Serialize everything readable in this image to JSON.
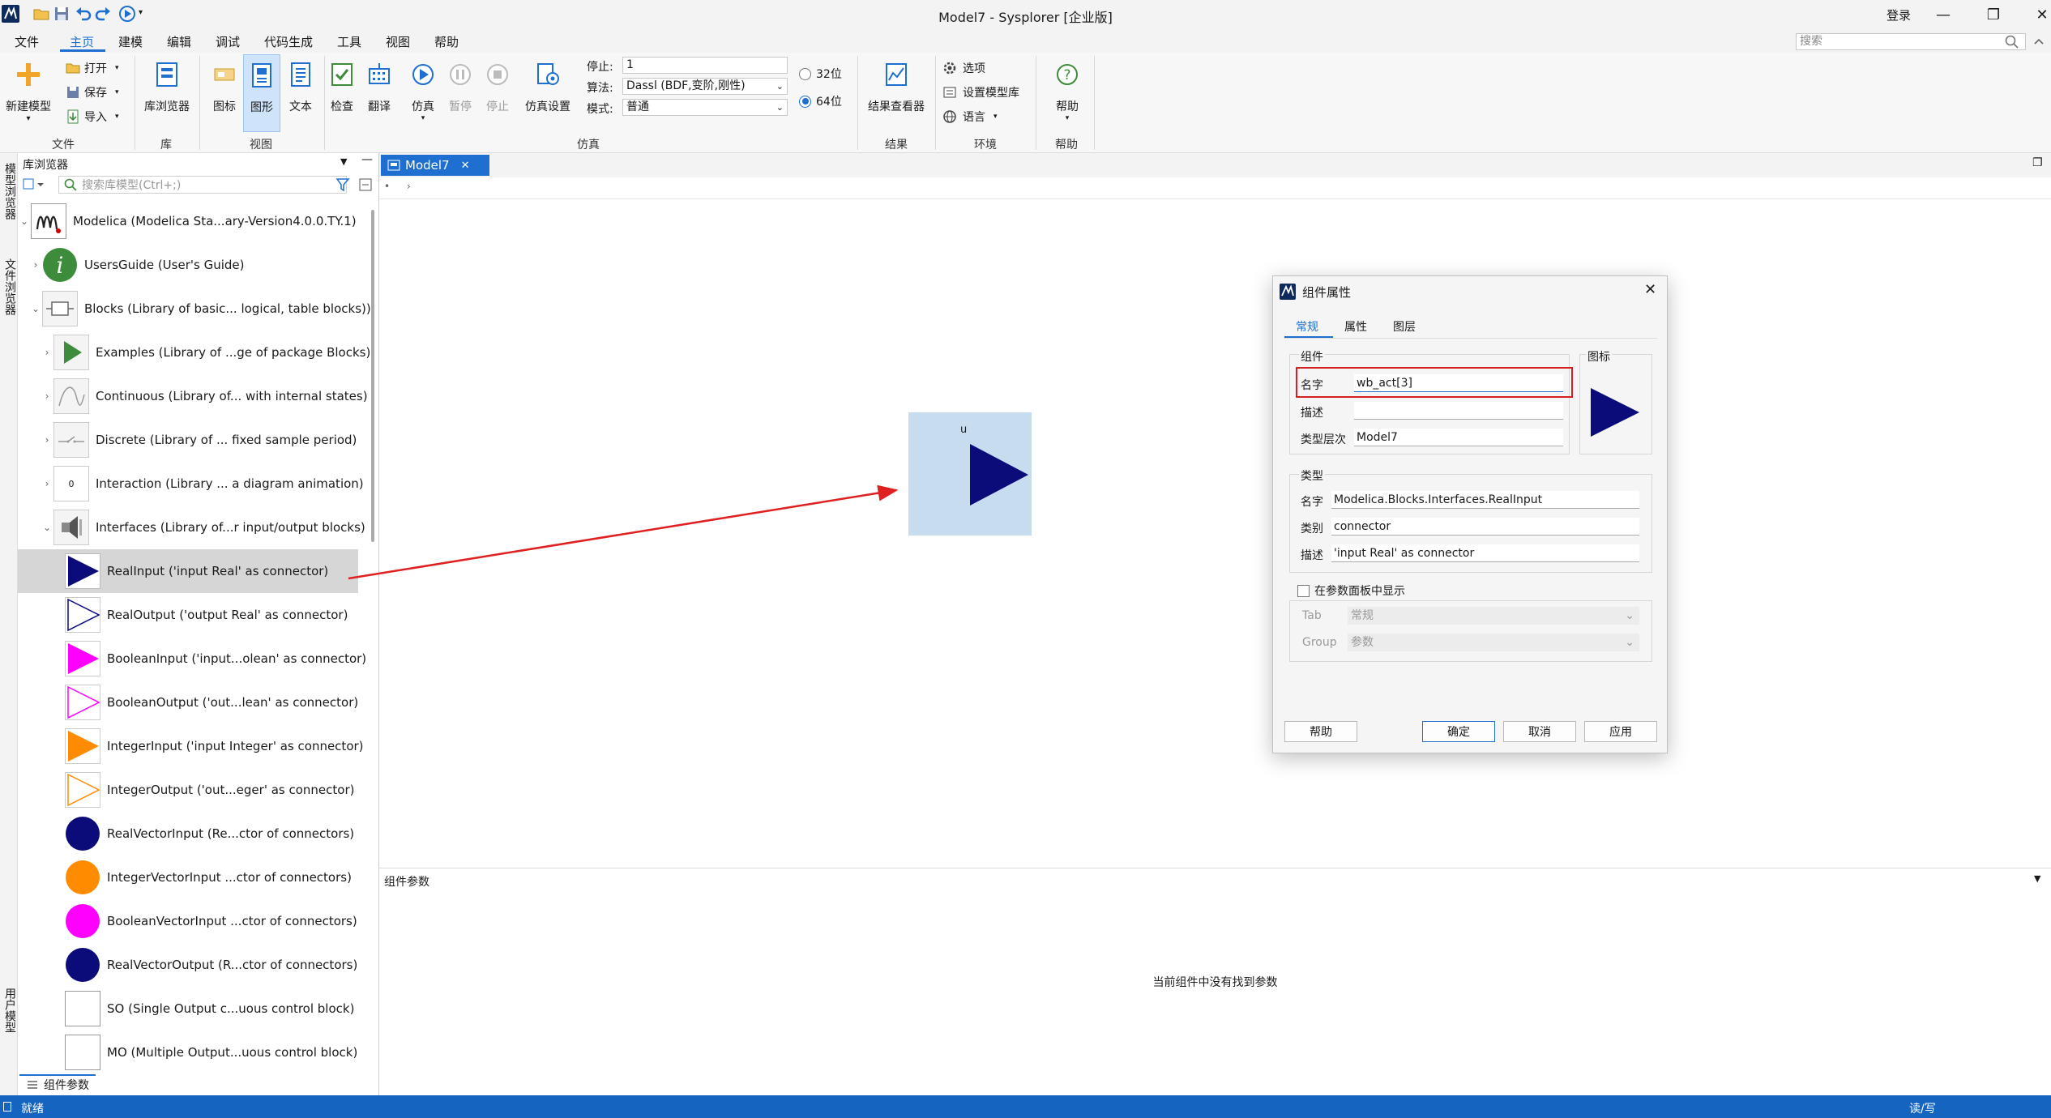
{
  "window": {
    "title": "Model7 - Sysplorer [企业版]",
    "login": "登录"
  },
  "menu": {
    "tabs": [
      "文件",
      "主页",
      "建模",
      "编辑",
      "调试",
      "代码生成",
      "工具",
      "视图",
      "帮助"
    ],
    "active": "主页",
    "search_placeholder": "搜索"
  },
  "ribbon": {
    "file": {
      "new_model": "新建模型",
      "open": "打开",
      "save": "保存",
      "import": "导入",
      "group": "文件"
    },
    "lib": {
      "browser": "库浏览器",
      "group": "库"
    },
    "view": {
      "icon": "图标",
      "diagram": "图形",
      "text": "文本",
      "group": "视图"
    },
    "sim": {
      "check": "检查",
      "translate": "翻译",
      "simulate": "仿真",
      "pause": "暂停",
      "stop": "停止",
      "settings": "仿真设置",
      "stop_label": "停止:",
      "stop_value": "1",
      "algo_label": "算法:",
      "algo_value": "Dassl (BDF,变阶,刚性)",
      "mode_label": "模式:",
      "mode_value": "普通",
      "bit32": "32位",
      "bit64": "64位",
      "group": "仿真"
    },
    "result": {
      "viewer": "结果查看器",
      "group": "结果"
    },
    "env": {
      "options": "选项",
      "set_lib": "设置模型库",
      "language": "语言",
      "group": "环境"
    },
    "help": {
      "help": "帮助",
      "group": "帮助"
    }
  },
  "vtabs": [
    "模型浏览器",
    "文件浏览器",
    "用户模型"
  ],
  "library": {
    "title": "库浏览器",
    "search_placeholder": "搜索库模型(Ctrl+;)",
    "items": [
      {
        "label": "Modelica (Modelica Sta...ary-Version4.0.0.TY.1)",
        "icon": "modelica-logo-icon"
      },
      {
        "label": "UsersGuide (User's Guide)",
        "icon": "info-icon"
      },
      {
        "label": "Blocks (Library of basic... logical, table blocks))",
        "icon": "blocks-icon"
      },
      {
        "label": "Examples (Library of ...ge of package Blocks)",
        "icon": "play-icon"
      },
      {
        "label": "Continuous (Library of... with internal states)",
        "icon": "continuous-icon"
      },
      {
        "label": "Discrete (Library of ... fixed sample period)",
        "icon": "discrete-icon"
      },
      {
        "label": "Interaction (Library ... a diagram animation)",
        "icon": "interaction-icon",
        "badge": "0"
      },
      {
        "label": "Interfaces (Library of...r input/output blocks)",
        "icon": "interfaces-icon"
      },
      {
        "label": "RealInput ('input Real' as connector)",
        "icon": "triangle-icon"
      },
      {
        "label": "RealOutput ('output Real' as connector)",
        "icon": "triangle-icon"
      },
      {
        "label": "BooleanInput ('input...olean' as connector)",
        "icon": "triangle-icon"
      },
      {
        "label": "BooleanOutput ('out...lean' as connector)",
        "icon": "triangle-icon"
      },
      {
        "label": "IntegerInput ('input Integer' as connector)",
        "icon": "triangle-icon"
      },
      {
        "label": "IntegerOutput ('out...eger' as connector)",
        "icon": "triangle-icon"
      },
      {
        "label": "RealVectorInput (Re...ctor of connectors)",
        "icon": "circle-icon"
      },
      {
        "label": "IntegerVectorInput ...ctor of connectors)",
        "icon": "circle-icon"
      },
      {
        "label": "BooleanVectorInput ...ctor of connectors)",
        "icon": "circle-icon"
      },
      {
        "label": "RealVectorOutput (R...ctor of connectors)",
        "icon": "circle-icon"
      },
      {
        "label": "SO (Single Output c...uous control block)",
        "icon": "square-icon"
      },
      {
        "label": "MO (Multiple Output...uous control block)",
        "icon": "square-icon"
      }
    ]
  },
  "colors": {
    "navy": "#0b0b7a",
    "magenta": "#ff00ff",
    "orange": "#ff8c00",
    "accent": "#1e6fd0",
    "green": "#3c8c3c",
    "red_box": "#d42020"
  },
  "doc": {
    "tab": "Model7",
    "canvas_label": "u",
    "params_title": "组件参数",
    "params_empty": "当前组件中没有找到参数"
  },
  "bottom_tab": "组件参数",
  "status": {
    "left": "就绪",
    "right": "读/写"
  },
  "dialog": {
    "title": "组件属性",
    "tabs": [
      "常规",
      "属性",
      "图层"
    ],
    "component_group": "组件",
    "icon_group": "图标",
    "name_label": "名字",
    "name_value": "wb_act[3]",
    "desc_label": "描述",
    "desc_value": "",
    "level_label": "类型层次",
    "level_value": "Model7",
    "type_group": "类型",
    "type_name_label": "名字",
    "type_name_value": "Modelica.Blocks.Interfaces.RealInput",
    "type_cat_label": "类别",
    "type_cat_value": "connector",
    "type_desc_label": "描述",
    "type_desc_value": "'input Real' as connector",
    "show_in_panel": "在参数面板中显示",
    "tab_label": "Tab",
    "tab_value": "常规",
    "group_label": "Group",
    "group_value": "参数",
    "btn_help": "帮助",
    "btn_ok": "确定",
    "btn_cancel": "取消",
    "btn_apply": "应用"
  }
}
